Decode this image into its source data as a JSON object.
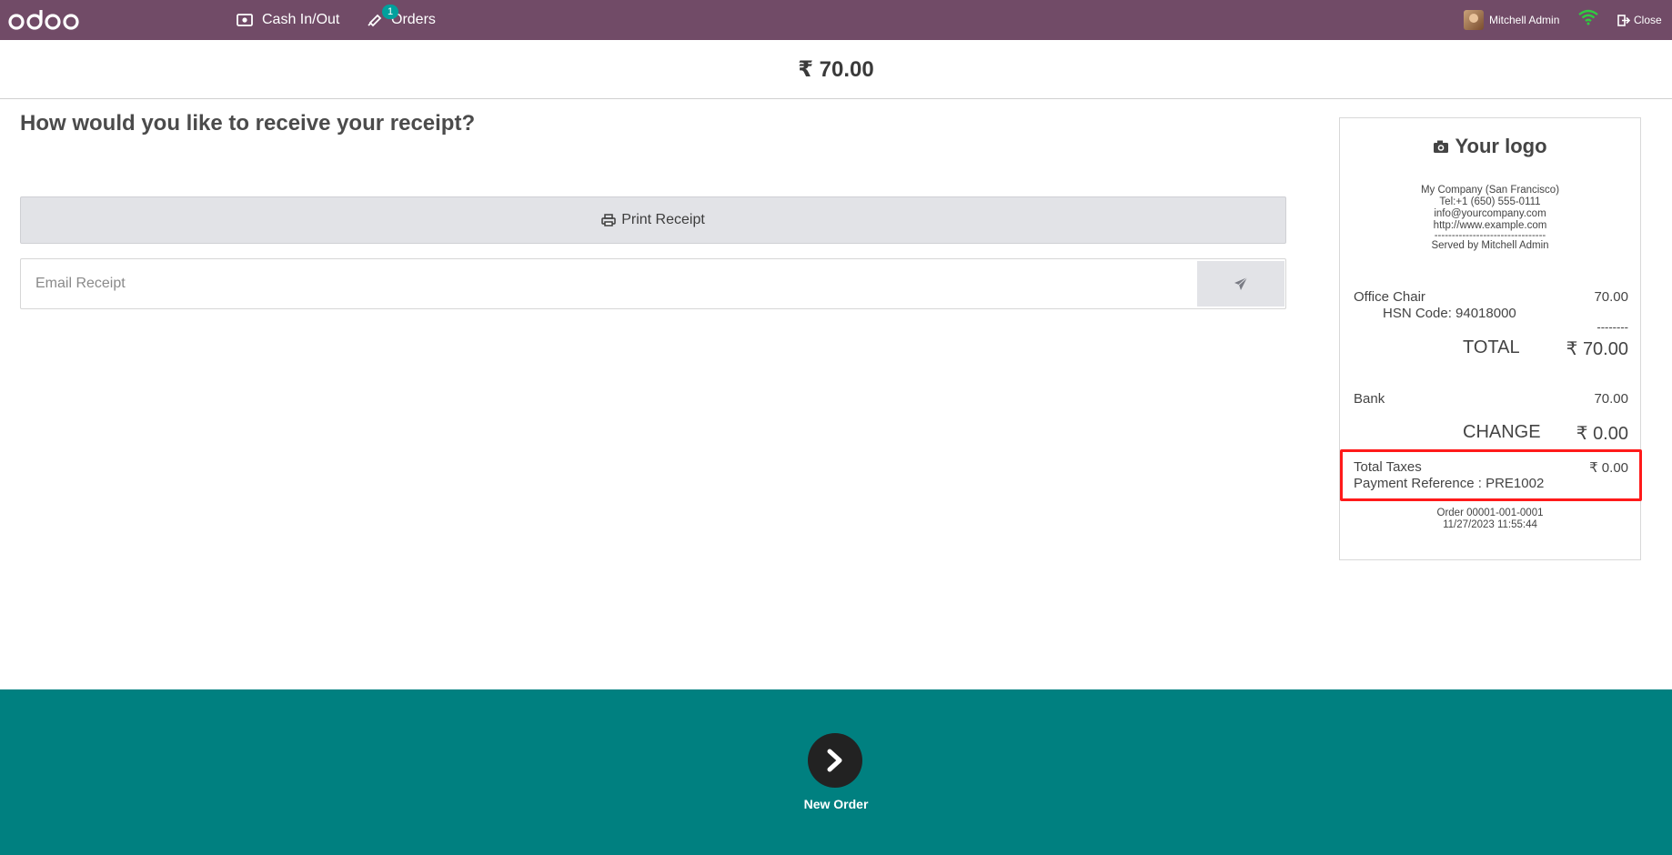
{
  "navbar": {
    "logo_text": "odoo",
    "cash_label": "Cash In/Out",
    "orders_label": "Orders",
    "orders_badge": "1",
    "user_name": "Mitchell Admin",
    "close_label": "Close",
    "color": "#714b67"
  },
  "amount": "₹ 70.00",
  "main": {
    "question": "How would you like to receive your receipt?",
    "print_label": "Print Receipt",
    "email_placeholder": "Email Receipt"
  },
  "receipt": {
    "logo_text": "Your logo",
    "company_lines": [
      "My Company (San Francisco)",
      "Tel:+1 (650) 555-0111",
      "info@yourcompany.com",
      "http://www.example.com",
      "--------------------------------",
      "Served by Mitchell Admin"
    ],
    "line_item": {
      "name": "Office Chair",
      "price": "70.00",
      "hsn": "HSN Code: 94018000"
    },
    "separator": "--------",
    "total_label": "TOTAL",
    "total_value": "₹ 70.00",
    "payment_label": "Bank",
    "payment_value": "70.00",
    "change_label": "CHANGE",
    "change_value": "₹ 0.00",
    "taxes_label": "Total Taxes",
    "taxes_value": "₹ 0.00",
    "payment_ref": "Payment Reference : PRE1002",
    "order_number": "Order 00001-001-0001",
    "order_date": "11/27/2023 11:55:44"
  },
  "footer": {
    "next_label": "New Order",
    "color": "#008080"
  }
}
